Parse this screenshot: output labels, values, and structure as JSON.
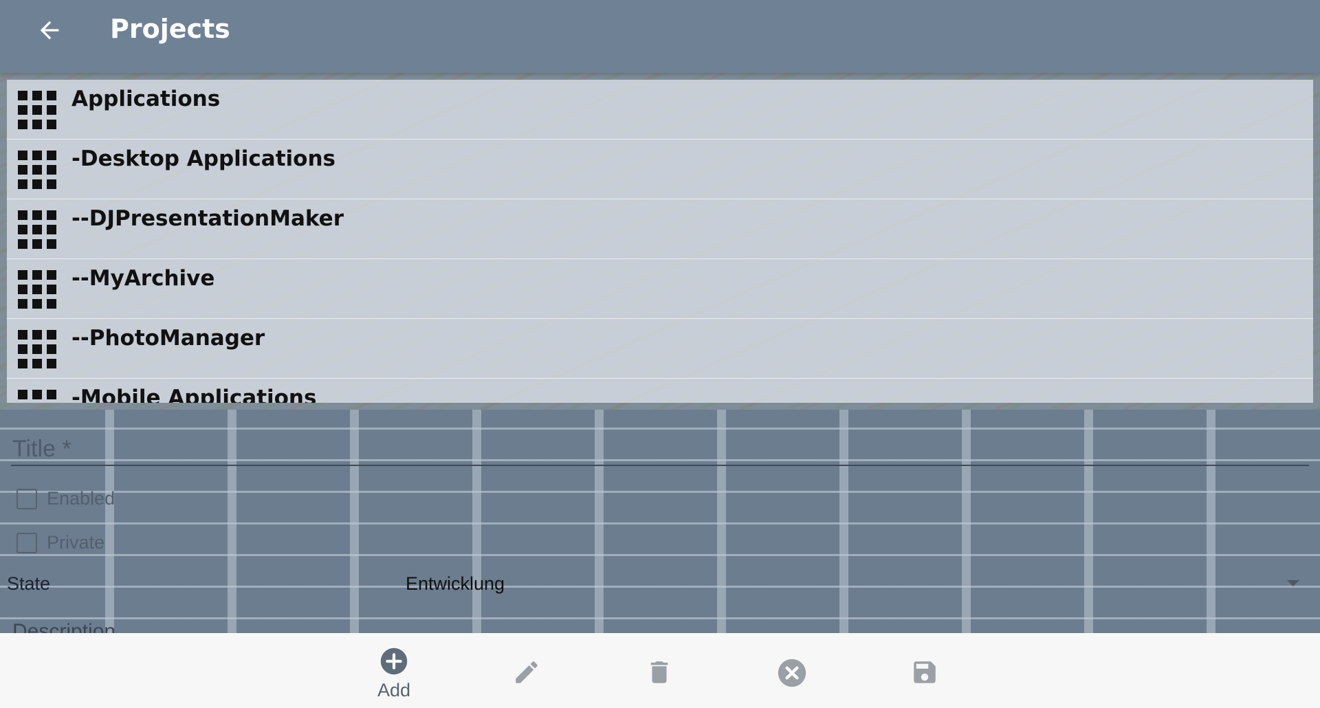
{
  "appbar": {
    "title": "Projects",
    "back_icon": "arrow-left-icon"
  },
  "projects": [
    {
      "label": "Applications"
    },
    {
      "label": "-Desktop Applications"
    },
    {
      "label": "--DJPresentationMaker"
    },
    {
      "label": "--MyArchive"
    },
    {
      "label": "--PhotoManager"
    },
    {
      "label": "-Mobile Applications"
    }
  ],
  "form": {
    "title_placeholder": "Title *",
    "title_value": "",
    "enabled_label": "Enabled",
    "enabled_checked": false,
    "private_label": "Private",
    "private_checked": false,
    "state_label": "State",
    "state_value": "Entwicklung",
    "description_label": "Description"
  },
  "toolbar": {
    "add_label": "Add",
    "add_icon": "add-circle-icon",
    "edit_icon": "pencil-icon",
    "delete_icon": "trash-icon",
    "cancel_icon": "close-circle-icon",
    "save_icon": "floppy-disk-icon"
  },
  "colors": {
    "appbar": "#6f8194",
    "toolbar_bg": "#f7f7f7",
    "icon_gray": "#9aa0a6",
    "add_icon": "#5f6d7b"
  }
}
